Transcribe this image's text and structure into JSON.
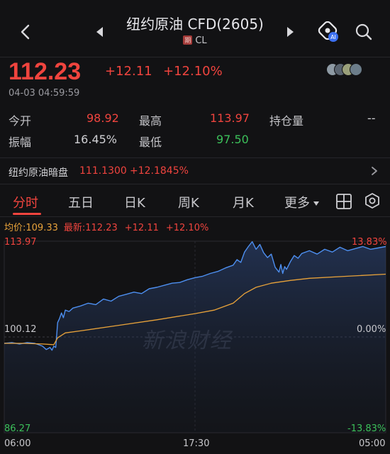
{
  "header": {
    "title": "纽约原油 CFD(2605)",
    "badge": "期",
    "code": "CL",
    "ai_badge": "AI"
  },
  "quote": {
    "price": "112.23",
    "change": "+12.11",
    "change_pct": "+12.10%",
    "timestamp": "04-03 04:59:59"
  },
  "stats": {
    "open_label": "今开",
    "open_value": "98.92",
    "high_label": "最高",
    "high_value": "113.97",
    "oi_label": "持仓量",
    "oi_value": "--",
    "amp_label": "振幅",
    "amp_value": "16.45%",
    "low_label": "最低",
    "low_value": "97.50"
  },
  "dark_pool": {
    "label": "纽约原油暗盘",
    "value": "111.1300",
    "pct": "+12.1845%"
  },
  "tabs": [
    {
      "label": "分时",
      "active": true
    },
    {
      "label": "五日",
      "active": false
    },
    {
      "label": "日K",
      "active": false
    },
    {
      "label": "周K",
      "active": false
    },
    {
      "label": "月K",
      "active": false
    },
    {
      "label": "更多",
      "active": false
    }
  ],
  "legend": {
    "avg": "均价:109.33",
    "latest": "最新:112.23",
    "change": "+12.11",
    "pct": "+12.10%"
  },
  "chart_data": {
    "type": "line",
    "x_ticks": [
      "06:00",
      "17:30",
      "05:00"
    ],
    "y_left_ticks": [
      "113.97",
      "100.12",
      "86.27"
    ],
    "y_right_ticks": [
      "13.83%",
      "0.00%",
      "-13.83%"
    ],
    "ylim": [
      86.27,
      113.97
    ],
    "watermark": "新浪财经",
    "series": [
      {
        "name": "最新",
        "color": "#4d8ff0",
        "x": [
          0,
          0.02,
          0.04,
          0.06,
          0.08,
          0.09,
          0.1,
          0.11,
          0.12,
          0.125,
          0.13,
          0.135,
          0.14,
          0.145,
          0.15,
          0.155,
          0.16,
          0.17,
          0.18,
          0.2,
          0.22,
          0.24,
          0.26,
          0.28,
          0.3,
          0.32,
          0.34,
          0.36,
          0.38,
          0.4,
          0.42,
          0.44,
          0.46,
          0.48,
          0.5,
          0.52,
          0.54,
          0.56,
          0.58,
          0.6,
          0.61,
          0.62,
          0.63,
          0.64,
          0.65,
          0.66,
          0.67,
          0.68,
          0.69,
          0.7,
          0.71,
          0.72,
          0.725,
          0.73,
          0.735,
          0.74,
          0.75,
          0.76,
          0.77,
          0.78,
          0.8,
          0.82,
          0.84,
          0.86,
          0.88,
          0.9,
          0.92,
          0.94,
          0.96,
          0.98,
          1.0
        ],
        "values": [
          99.2,
          99.3,
          99.1,
          99.3,
          99.2,
          99.0,
          98.8,
          98.3,
          98.6,
          98.2,
          98.8,
          98.6,
          102.2,
          102.8,
          103.6,
          102.9,
          104.0,
          103.8,
          104.3,
          104.6,
          105.0,
          104.8,
          105.6,
          105.3,
          106.0,
          106.3,
          106.6,
          106.4,
          107.1,
          107.3,
          107.6,
          107.9,
          108.0,
          108.4,
          108.7,
          108.9,
          109.3,
          109.6,
          110.1,
          110.5,
          111.3,
          110.9,
          112.4,
          113.2,
          113.9,
          112.8,
          113.5,
          112.3,
          111.6,
          112.1,
          110.2,
          109.5,
          110.6,
          109.3,
          110.3,
          109.9,
          111.0,
          111.9,
          111.5,
          112.2,
          112.6,
          112.1,
          112.8,
          112.4,
          113.1,
          112.6,
          112.9,
          113.2,
          112.8,
          113.0,
          113.2
        ]
      },
      {
        "name": "均价",
        "color": "#e8a23a",
        "x": [
          0,
          0.05,
          0.1,
          0.13,
          0.14,
          0.16,
          0.2,
          0.3,
          0.4,
          0.5,
          0.55,
          0.6,
          0.63,
          0.66,
          0.7,
          0.75,
          0.8,
          0.9,
          1.0
        ],
        "values": [
          99.2,
          99.2,
          99.1,
          99.0,
          100.0,
          100.7,
          101.0,
          101.8,
          102.6,
          103.5,
          104.0,
          105.0,
          106.4,
          107.3,
          107.9,
          108.3,
          108.6,
          108.9,
          109.2
        ]
      }
    ]
  }
}
